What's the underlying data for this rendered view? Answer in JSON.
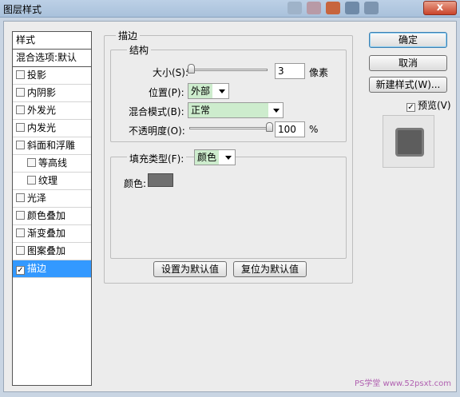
{
  "window": {
    "title": "图层样式",
    "close_label": "x"
  },
  "style_list": {
    "header": "样式",
    "blend_options": "混合选项:默认",
    "items": [
      {
        "label": "投影",
        "checked": false
      },
      {
        "label": "内阴影",
        "checked": false
      },
      {
        "label": "外发光",
        "checked": false
      },
      {
        "label": "内发光",
        "checked": false
      },
      {
        "label": "斜面和浮雕",
        "checked": false
      },
      {
        "label": "等高线",
        "checked": false
      },
      {
        "label": "纹理",
        "checked": false
      },
      {
        "label": "光泽",
        "checked": false
      },
      {
        "label": "颜色叠加",
        "checked": false
      },
      {
        "label": "渐变叠加",
        "checked": false
      },
      {
        "label": "图案叠加",
        "checked": false
      },
      {
        "label": "描边",
        "checked": true
      }
    ]
  },
  "stroke": {
    "group_title": "描边",
    "structure": {
      "title": "结构",
      "size_label": "大小(S):",
      "size_value": "3",
      "size_unit": "像素",
      "position_label": "位置(P):",
      "position_value": "外部",
      "blend_label": "混合模式(B):",
      "blend_value": "正常",
      "opacity_label": "不透明度(O):",
      "opacity_value": "100",
      "opacity_unit": "%"
    },
    "fill": {
      "type_label": "填充类型(F):",
      "type_value": "颜色",
      "color_label": "颜色:",
      "color": "#6f6f6f"
    },
    "set_default": "设置为默认值",
    "reset_default": "复位为默认值"
  },
  "buttons": {
    "ok": "确定",
    "cancel": "取消",
    "new_style": "新建样式(W)...",
    "preview_label": "预览(V)",
    "preview_checked": true
  },
  "watermark": "PS学堂 www.52psxt.com"
}
